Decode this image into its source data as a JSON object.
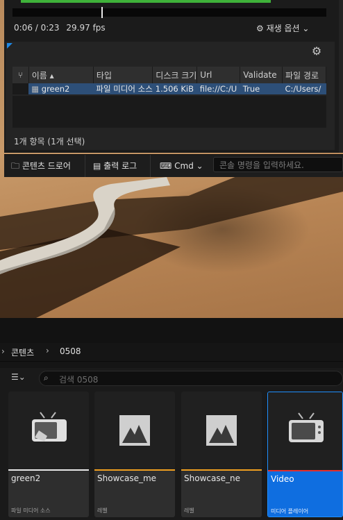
{
  "player": {
    "time": "0:06 / 0:23",
    "fps": "29.97 fps",
    "options_label": "재생 옵션"
  },
  "media_table": {
    "columns": [
      "이름",
      "타입",
      "디스크 크기",
      "Url",
      "Validate",
      "파일 경로"
    ],
    "rows": [
      {
        "name": "green2",
        "type": "파일 미디어 소스",
        "size": "1.506 KiB",
        "url": "file://C:/U",
        "validate": "True",
        "path": "C:/Users/"
      }
    ],
    "summary": "1개 항목 (1개 선택)"
  },
  "toolbar": {
    "content_drawer": "콘텐츠 드로어",
    "output_log": "출력 로그",
    "cmd": "Cmd",
    "console_placeholder": "콘솔 명령을 입력하세요."
  },
  "content_browser": {
    "breadcrumb": [
      "콘텐츠",
      "0508"
    ],
    "search_placeholder": "검색 0508",
    "tiles": [
      {
        "name": "green2",
        "type": "파일 미디어 소스",
        "icon": "tv-media-source-icon",
        "bar_color": "#e8e8e8",
        "selected": false
      },
      {
        "name": "Showcase_me",
        "type": "레벨",
        "icon": "level-icon",
        "bar_color": "#f0a020",
        "selected": false
      },
      {
        "name": "Showcase_ne",
        "type": "레벨",
        "icon": "level-icon",
        "bar_color": "#f0a020",
        "selected": false
      },
      {
        "name": "Video",
        "type": "미디어 플레이어",
        "icon": "tv-icon",
        "bar_color": "#e03030",
        "selected": true
      }
    ]
  },
  "colors": {
    "accent_blue": "#1e90ff",
    "selection_row": "#2d4f78",
    "playback_green": "#3fb23a"
  }
}
